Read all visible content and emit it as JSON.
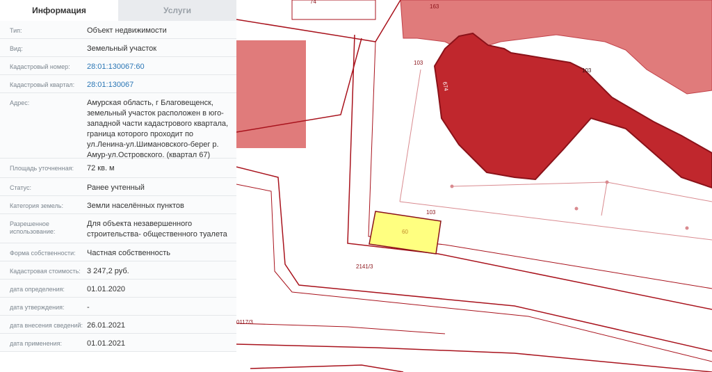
{
  "tabs": {
    "info": "Информация",
    "services": "Услуги"
  },
  "rows": [
    {
      "label": "Тип:",
      "value": "Объект недвижимости"
    },
    {
      "label": "Вид:",
      "value": "Земельный участок"
    },
    {
      "label": "Кадастровый номер:",
      "value": "28:01:130067:60",
      "link": true
    },
    {
      "label": "Кадастровый квартал:",
      "value": "28:01:130067",
      "link": true
    },
    {
      "label": "Адрес:",
      "value": "Амурская область, г Благовещенск, земельный участок расположен в юго-западной части кадастрового квартала, граница которого проходит по ул.Ленина-ул.Шимановского-берег р. Амур-ул.Островского. (квартал 67)"
    },
    {
      "label": "Площадь уточненная:",
      "value": "72 кв. м"
    },
    {
      "label": "Статус:",
      "value": "Ранее учтенный"
    },
    {
      "label": "Категория земель:",
      "value": "Земли населённых пунктов"
    },
    {
      "label": "Разрешенное использование:",
      "value": "Для объекта незавершенного строительства- общественного туалета"
    },
    {
      "label": "Форма собственности:",
      "value": "Частная собственность"
    },
    {
      "label": "Кадастровая стоимость:",
      "value": "3 247,2 руб."
    },
    {
      "label": "дата определения:",
      "value": "01.01.2020"
    },
    {
      "label": "дата утверждения:",
      "value": "-"
    },
    {
      "label": "дата внесения сведений:",
      "value": "26.01.2021"
    },
    {
      "label": "дата применения:",
      "value": "01.01.2021"
    }
  ],
  "map": {
    "labels": {
      "parcel_74": "74",
      "parcel_163": "163",
      "parcel_103_a": "103",
      "parcel_103_b": "103",
      "parcel_103_c": "103",
      "parcel_674": "674",
      "parcel_60": "60",
      "parcel_2141_3": "2141/3",
      "parcel_117_3": "0117/3"
    },
    "colors": {
      "selected_parcel": "#ffff80",
      "building_dark": "#c0272d",
      "building_light": "#e07b7b",
      "boundary": "#a8121c"
    }
  }
}
